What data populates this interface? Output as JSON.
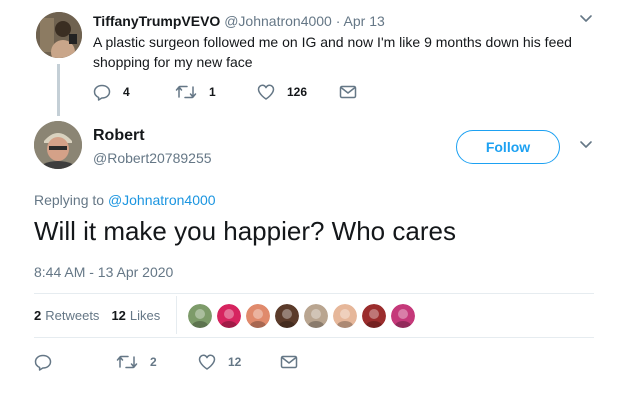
{
  "parent": {
    "display_name": "TiffanyTrumpVEVO",
    "handle": "@Johnatron4000",
    "dot": "·",
    "date": "Apr 13",
    "text": "A plastic surgeon followed me on IG and now I'm like 9 months down his feed shopping for my new face",
    "reply_count": "4",
    "retweet_count": "1",
    "like_count": "126"
  },
  "main": {
    "display_name": "Robert",
    "handle": "@Robert20789255",
    "follow_label": "Follow",
    "replying_prefix": "Replying to",
    "replying_handle": "@Johnatron4000",
    "text": "Will it make you happier? Who cares",
    "timestamp": "8:44 AM - 13 Apr 2020",
    "retweets_count": "2",
    "retweets_label": "Retweets",
    "likes_count": "12",
    "likes_label": "Likes",
    "action_retweet_count": "2",
    "action_like_count": "12"
  },
  "likers": [
    {
      "color": "#7d9b6a"
    },
    {
      "color": "#d6245f"
    },
    {
      "color": "#e08a6c"
    },
    {
      "color": "#5b3b2a"
    },
    {
      "color": "#b9a590"
    },
    {
      "color": "#e6b79a"
    },
    {
      "color": "#9b2d2d"
    },
    {
      "color": "#c5397a"
    }
  ],
  "colors": {
    "accent": "#1da1f2",
    "text": "#14171a",
    "muted": "#657786",
    "divider": "#e6ecf0"
  }
}
